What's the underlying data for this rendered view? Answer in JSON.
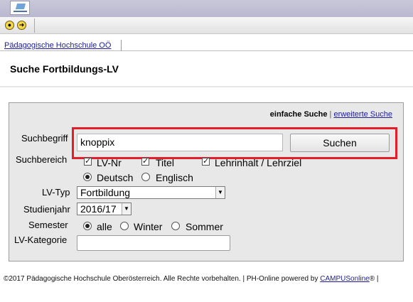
{
  "header": {
    "logo_icon": "institution-logo",
    "toolbar_icons": [
      "gear-icon",
      "arrow-right-icon"
    ]
  },
  "tabs": [
    {
      "label": "Pädagogische Hochschule OÖ"
    }
  ],
  "page": {
    "title": "Suche Fortbildungs-LV"
  },
  "search": {
    "mode_active": "einfache Suche",
    "mode_separator": "|",
    "mode_link": "erweiterte Suche",
    "term_label": "Suchbegriff",
    "term_value": "knoppix",
    "submit_label": "Suchen",
    "scope_label": "Suchbereich",
    "scope_options": [
      {
        "label": "LV-Nr",
        "checked": true
      },
      {
        "label": "Titel",
        "checked": true
      },
      {
        "label": "Lehrinhalt / Lehrziel",
        "checked": true
      }
    ],
    "language_options": [
      {
        "label": "Deutsch",
        "selected": true
      },
      {
        "label": "Englisch",
        "selected": false
      }
    ],
    "type_label": "LV-Typ",
    "type_value": "Fortbildung",
    "year_label": "Studienjahr",
    "year_value": "2016/17",
    "semester_label": "Semester",
    "semester_options": [
      {
        "label": "alle",
        "selected": true
      },
      {
        "label": "Winter",
        "selected": false
      },
      {
        "label": "Sommer",
        "selected": false
      }
    ],
    "category_label": "LV-Kategorie",
    "category_value": ""
  },
  "footer": {
    "text": "©2017 Pädagogische Hochschule Oberösterreich. Alle Rechte vorbehalten. | PH-Online powered by",
    "link": "CAMPUSonline",
    "suffix": "® |"
  },
  "colors": {
    "highlight": "#e31d2a",
    "link": "#1d1d99",
    "panel": "#e8e8e8"
  }
}
